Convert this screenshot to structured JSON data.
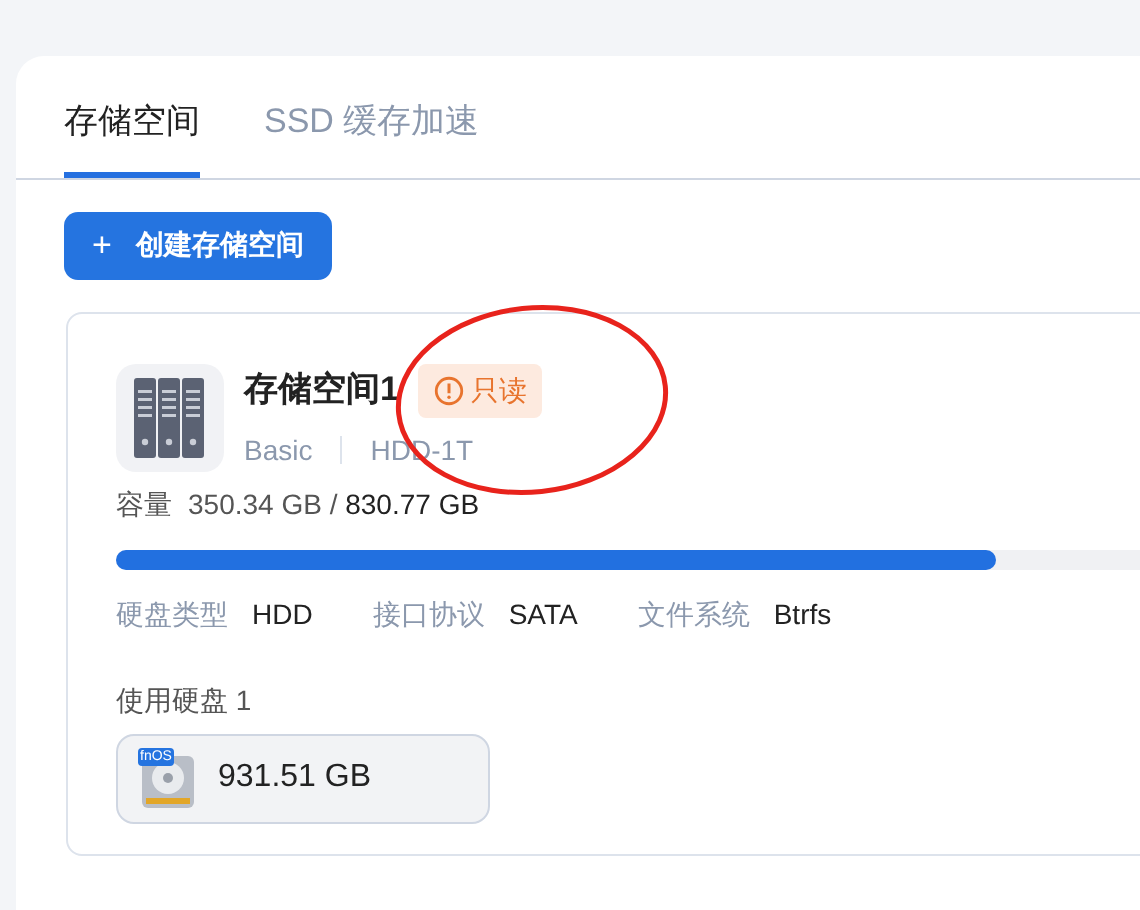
{
  "tabs": [
    {
      "label": "存储空间",
      "selected": true
    },
    {
      "label": "SSD 缓存加速",
      "selected": false
    }
  ],
  "create_button": {
    "icon": "+",
    "label": "创建存储空间"
  },
  "pool": {
    "title": "存储空间1",
    "badge": "只读",
    "raid": "Basic",
    "disk_label": "HDD-1T",
    "capacity_label": "容量",
    "used": "350.34 GB",
    "separator": "/",
    "total": "830.77 GB",
    "level": 0.83,
    "specs": [
      {
        "label": "硬盘类型",
        "value": "HDD"
      },
      {
        "label": "接口协议",
        "value": "SATA"
      },
      {
        "label": "文件系统",
        "value": "Btrfs"
      }
    ],
    "disks_label": "使用硬盘 1",
    "disks": [
      {
        "logo": "fnOS",
        "size": "931.51 GB"
      }
    ]
  }
}
